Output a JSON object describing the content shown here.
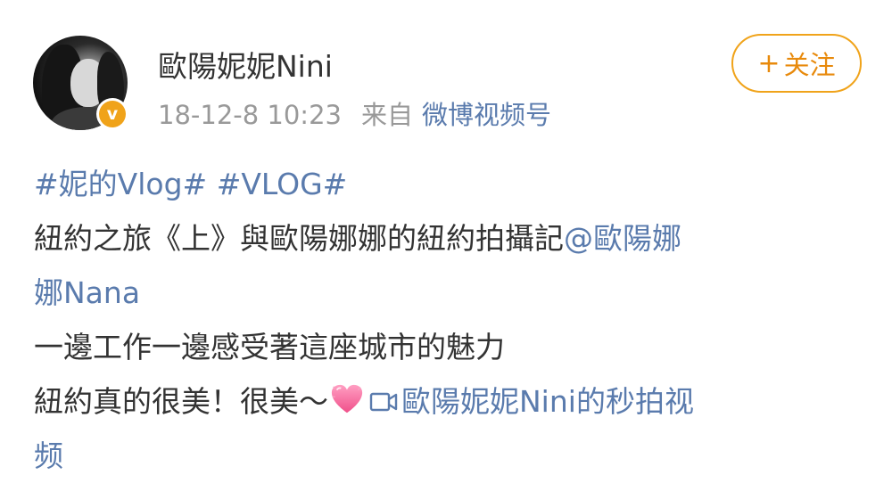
{
  "post": {
    "author": "歐陽妮妮Nini",
    "timestamp": "18-12-8 10:23",
    "source_prefix": "来自",
    "source": "微博视频号",
    "follow_label": "关注",
    "follow_plus": "+",
    "verified_badge": "v"
  },
  "content": {
    "hashtag1": "#妮的Vlog#",
    "hashtag2": "#VLOG#",
    "line2_text": "紐約之旅《上》與歐陽娜娜的紐約拍攝記",
    "mention_part1": "@歐陽娜",
    "mention_part2": "娜Nana",
    "line4_text": "一邊工作一邊感受著這座城市的魅力",
    "line5_text": "紐約真的很美！很美～",
    "video_link_part1": "歐陽妮妮Nini的秒拍视",
    "video_link_part2": "频"
  },
  "icons": {
    "heart": "pink-heart-emoji",
    "video": "video-camera-icon",
    "badge": "verified-v-badge"
  },
  "colors": {
    "link": "#5a7bad",
    "follow_accent": "#f0a31a",
    "meta_gray": "#999999"
  }
}
